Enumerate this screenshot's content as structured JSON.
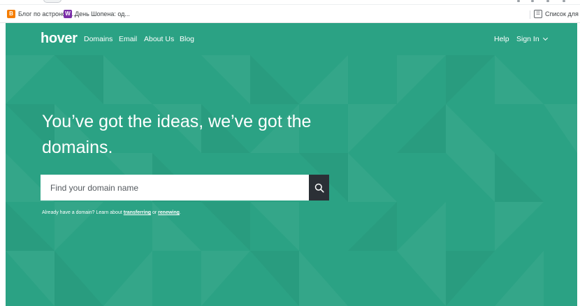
{
  "browser": {
    "bookmarks": [
      {
        "label": "Блог по астроном...",
        "icon": "blogger-icon"
      },
      {
        "label": "День Шопена: од...",
        "icon": "site-w-icon"
      }
    ],
    "reading_list": {
      "label": "Список для чтен",
      "icon": "reading-list-icon"
    }
  },
  "nav": {
    "logo": "hover",
    "links": [
      "Domains",
      "Email",
      "About Us",
      "Blog"
    ],
    "right": {
      "help": "Help",
      "sign_in": "Sign In"
    }
  },
  "hero": {
    "headline_line1": "You’ve got the ideas, we’ve got the",
    "headline_line2": "domains.",
    "search_placeholder": "Find your domain name",
    "search_icon": "search-icon",
    "helper_prefix": "Already have a domain? Learn about ",
    "transfer_link": "transferring",
    "helper_or": " or ",
    "renew_link": "renewing",
    "helper_suffix": "."
  },
  "colors": {
    "hero_bg": "#2ba284",
    "search_button": "#2b3036",
    "text": "#ffffff"
  }
}
